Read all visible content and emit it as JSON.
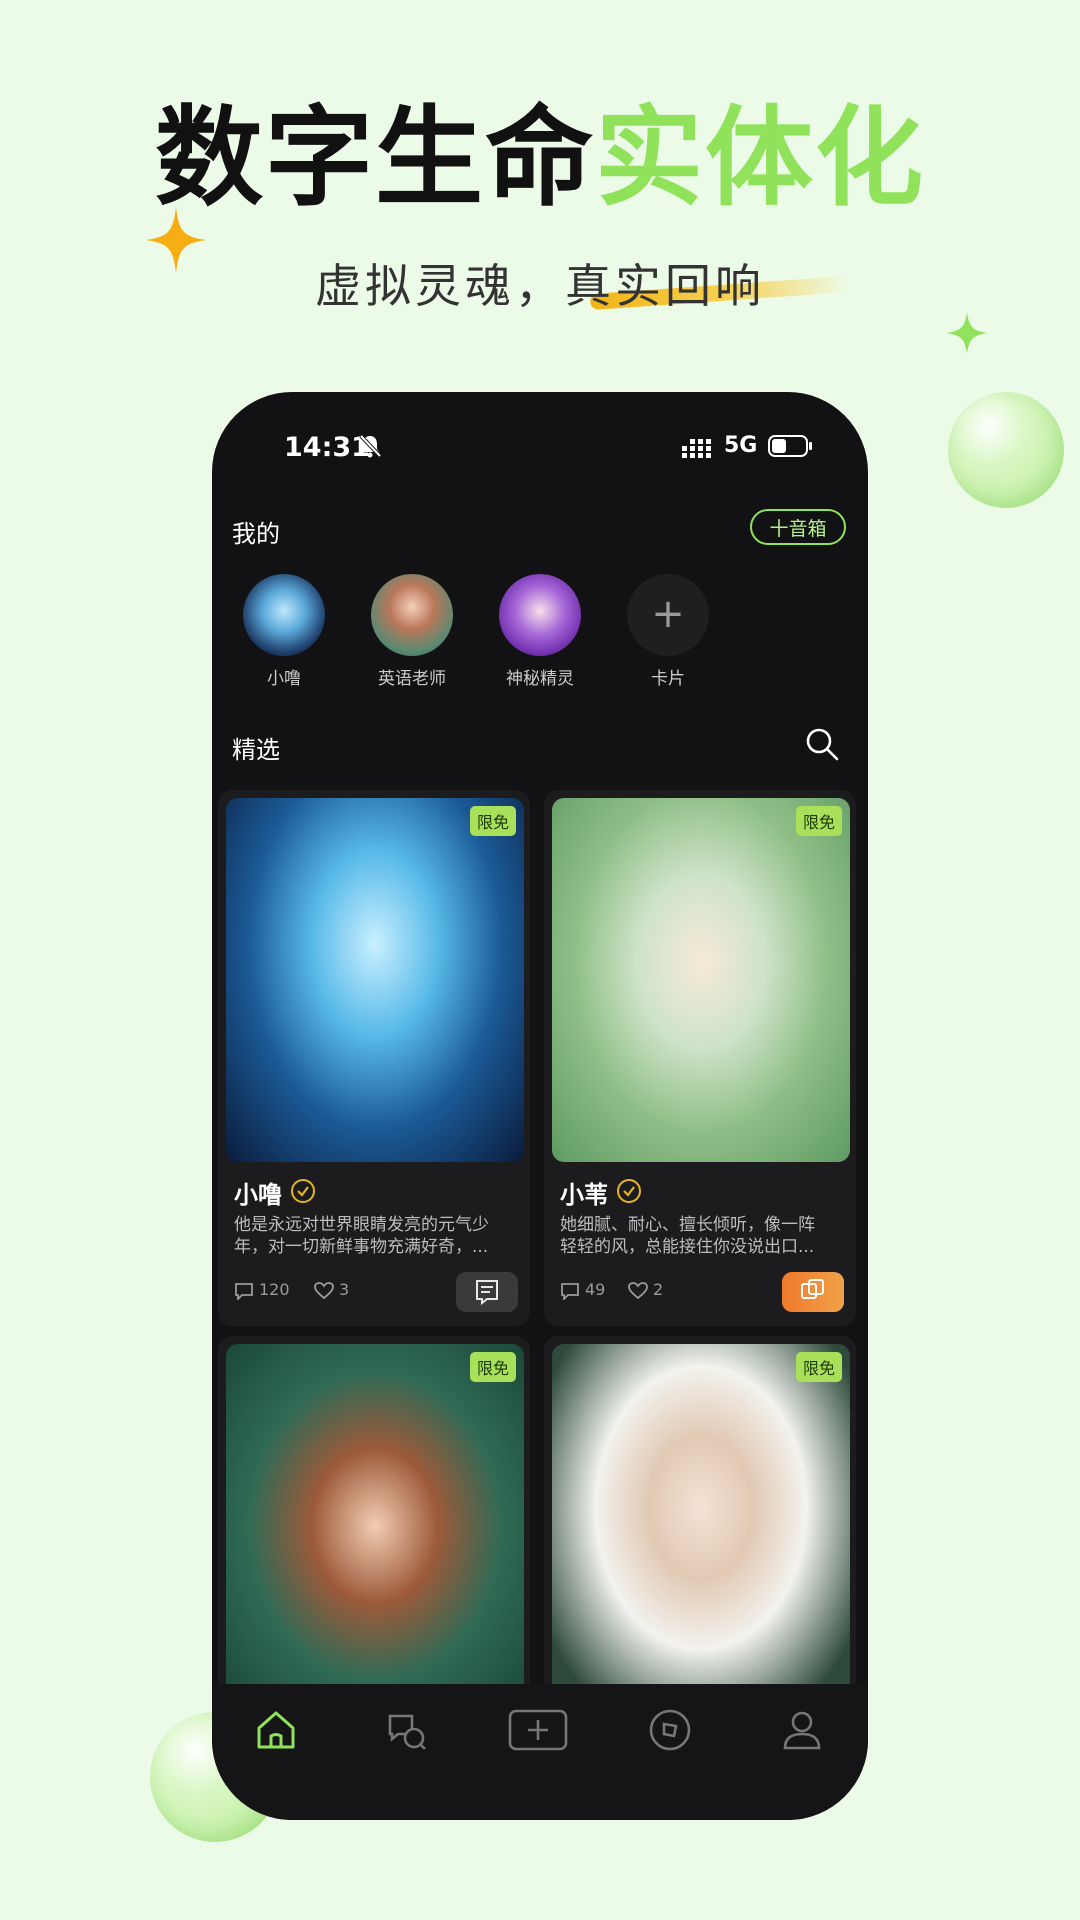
{
  "promo": {
    "headline_dark": "数字生命",
    "headline_green": "实体化",
    "subline": "虚拟灵魂，真实回响",
    "accent_green": "#8fe25a",
    "accent_yellow": "#f2b517"
  },
  "status_bar": {
    "time": "14:31",
    "network": "5G"
  },
  "my_section": {
    "title": "我的",
    "add_button": "十音箱",
    "avatars": [
      {
        "label": "小噜"
      },
      {
        "label": "英语老师"
      },
      {
        "label": "神秘精灵"
      }
    ],
    "add_card_label": "卡片",
    "add_card_glyph": "+"
  },
  "featured": {
    "title": "精选",
    "cards": [
      {
        "badge": "限免",
        "name": "小噜",
        "desc_line1": "他是永远对世界眼睛发亮的元气少",
        "desc_line2": "年，对一切新鲜事物充满好奇，...",
        "comments": "120",
        "likes": "3"
      },
      {
        "badge": "限免",
        "name": "小苇",
        "desc_line1": "她细腻、耐心、擅长倾听，像一阵",
        "desc_line2": "轻轻的风，总能接住你没说出口...",
        "comments": "49",
        "likes": "2"
      },
      {
        "badge": "限免"
      },
      {
        "badge": "限免"
      }
    ]
  },
  "tabbar": {
    "icons": [
      "home-icon",
      "chat-icon",
      "create-icon",
      "discover-icon",
      "profile-icon"
    ]
  }
}
